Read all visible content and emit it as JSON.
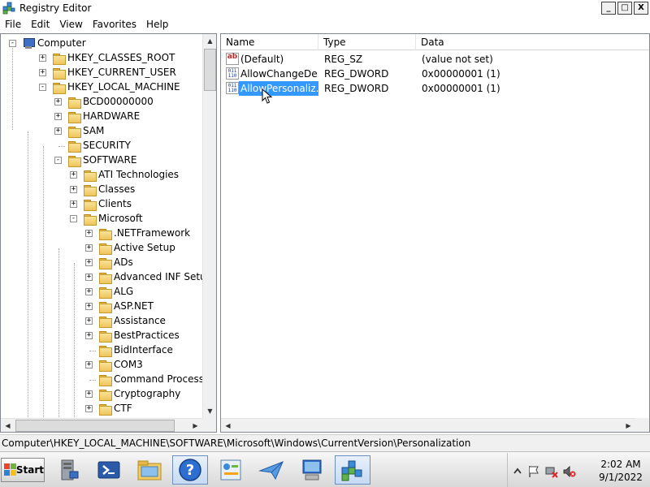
{
  "window": {
    "title": "Registry Editor",
    "controls": {
      "minimize": "_",
      "maximize": "□",
      "close": "X"
    }
  },
  "menu": [
    "File",
    "Edit",
    "View",
    "Favorites",
    "Help"
  ],
  "tree": {
    "root": "Computer",
    "items": [
      {
        "label": "HKEY_CLASSES_ROOT",
        "depth": 1,
        "expander": "+"
      },
      {
        "label": "HKEY_CURRENT_USER",
        "depth": 1,
        "expander": "+"
      },
      {
        "label": "HKEY_LOCAL_MACHINE",
        "depth": 1,
        "expander": "-"
      },
      {
        "label": "BCD00000000",
        "depth": 2,
        "expander": "+"
      },
      {
        "label": "HARDWARE",
        "depth": 2,
        "expander": "+"
      },
      {
        "label": "SAM",
        "depth": 2,
        "expander": "+"
      },
      {
        "label": "SECURITY",
        "depth": 2,
        "expander": ""
      },
      {
        "label": "SOFTWARE",
        "depth": 2,
        "expander": "-"
      },
      {
        "label": "ATI Technologies",
        "depth": 3,
        "expander": "+"
      },
      {
        "label": "Classes",
        "depth": 3,
        "expander": "+"
      },
      {
        "label": "Clients",
        "depth": 3,
        "expander": "+"
      },
      {
        "label": "Microsoft",
        "depth": 3,
        "expander": "-"
      },
      {
        "label": ".NETFramework",
        "depth": 4,
        "expander": "+"
      },
      {
        "label": "Active Setup",
        "depth": 4,
        "expander": "+"
      },
      {
        "label": "ADs",
        "depth": 4,
        "expander": "+"
      },
      {
        "label": "Advanced INF Setup",
        "depth": 4,
        "expander": "+"
      },
      {
        "label": "ALG",
        "depth": 4,
        "expander": "+"
      },
      {
        "label": "ASP.NET",
        "depth": 4,
        "expander": "+"
      },
      {
        "label": "Assistance",
        "depth": 4,
        "expander": "+"
      },
      {
        "label": "BestPractices",
        "depth": 4,
        "expander": "+"
      },
      {
        "label": "BidInterface",
        "depth": 4,
        "expander": ""
      },
      {
        "label": "COM3",
        "depth": 4,
        "expander": "+"
      },
      {
        "label": "Command Processor",
        "depth": 4,
        "expander": ""
      },
      {
        "label": "Cryptography",
        "depth": 4,
        "expander": "+"
      },
      {
        "label": "CTF",
        "depth": 4,
        "expander": "+"
      }
    ]
  },
  "list": {
    "columns": [
      "Name",
      "Type",
      "Data"
    ],
    "rows": [
      {
        "icon": "string-value-icon",
        "name": "(Default)",
        "type": "REG_SZ",
        "data": "(value not set)"
      },
      {
        "icon": "binary-value-icon",
        "name": "AllowChangeDe...",
        "type": "REG_DWORD",
        "data": "0x00000001 (1)"
      },
      {
        "icon": "binary-value-icon",
        "name": "AllowPersonaliz...",
        "type": "REG_DWORD",
        "data": "0x00000001 (1)",
        "selected": true
      }
    ]
  },
  "status": {
    "path": "Computer\\HKEY_LOCAL_MACHINE\\SOFTWARE\\Microsoft\\Windows\\CurrentVersion\\Personalization"
  },
  "taskbar": {
    "start_label": "Start",
    "icons": [
      "server-manager-icon",
      "powershell-icon",
      "explorer-icon",
      "help-icon",
      "control-panel-icon",
      "send-icon",
      "remote-desktop-icon",
      "registry-editor-icon"
    ],
    "clock_time": "2:02 AM",
    "clock_date": "9/1/2022"
  },
  "colors": {
    "selection": "#3399ff",
    "folder": "#eec45a"
  }
}
